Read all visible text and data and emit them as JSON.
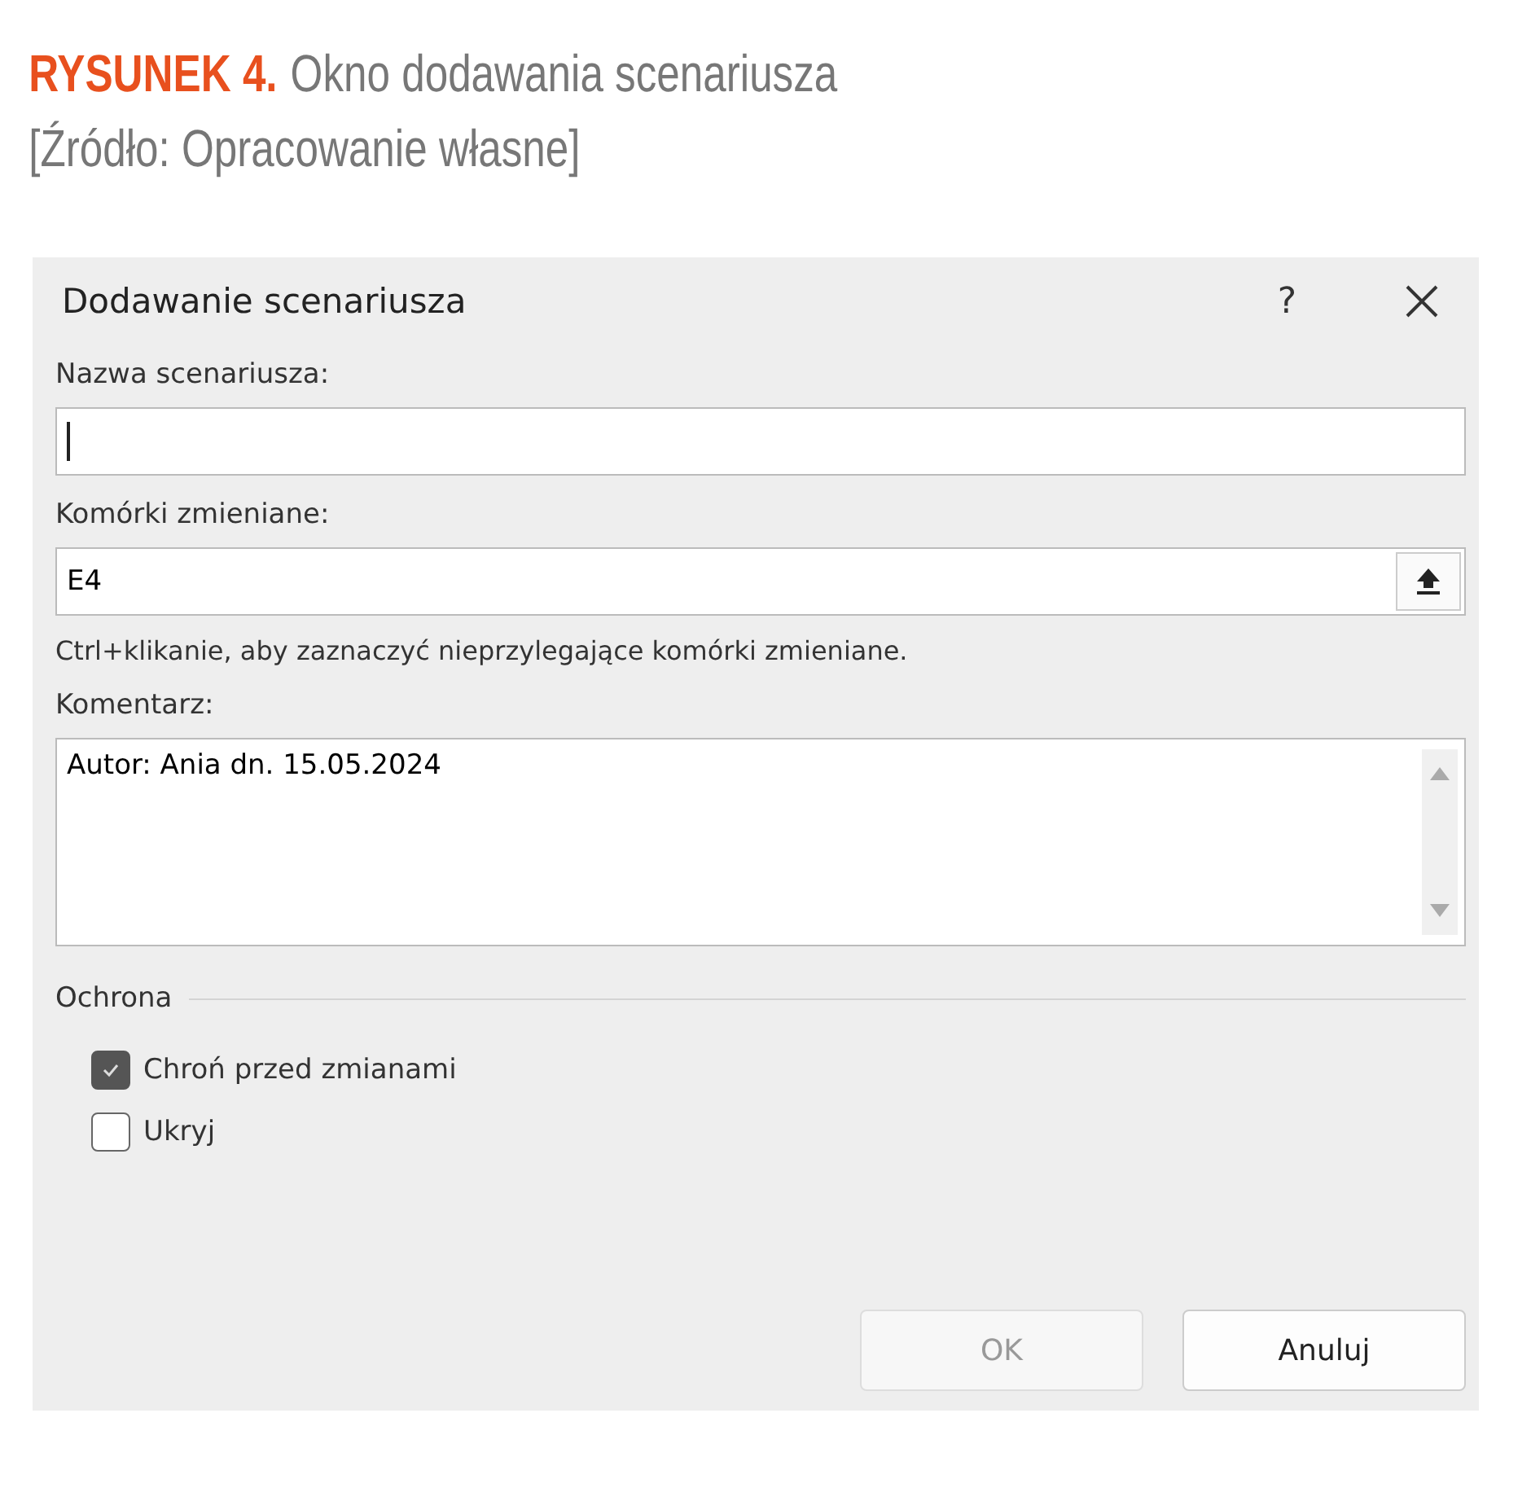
{
  "caption": {
    "label": "RYSUNEK 4.",
    "title": "Okno dodawania scenariusza",
    "source": "[Źródło: Opracowanie własne]"
  },
  "window": {
    "title": "Dodawanie scenariusza",
    "help": "?"
  },
  "fields": [
    {
      "kind": "text",
      "label": "Nazwa scenariusza:",
      "focused": true
    },
    {
      "kind": "range",
      "label": "Komórki zmieniane:",
      "value": "E4",
      "hint": "Ctrl+klikanie, aby zaznaczyć nieprzylegające komórki zmieniane."
    },
    {
      "kind": "area",
      "label": "Komentarz:",
      "value": "Autor: Ania dn. 15.05.2024"
    }
  ],
  "protection": {
    "title": "Ochrona",
    "options": [
      {
        "label": "Chroń przed zmianami",
        "checked": true
      },
      {
        "label": "Ukryj",
        "checked": false
      }
    ]
  },
  "buttons": [
    {
      "label": "OK",
      "disabled": true
    },
    {
      "label": "Anuluj",
      "disabled": false
    }
  ]
}
